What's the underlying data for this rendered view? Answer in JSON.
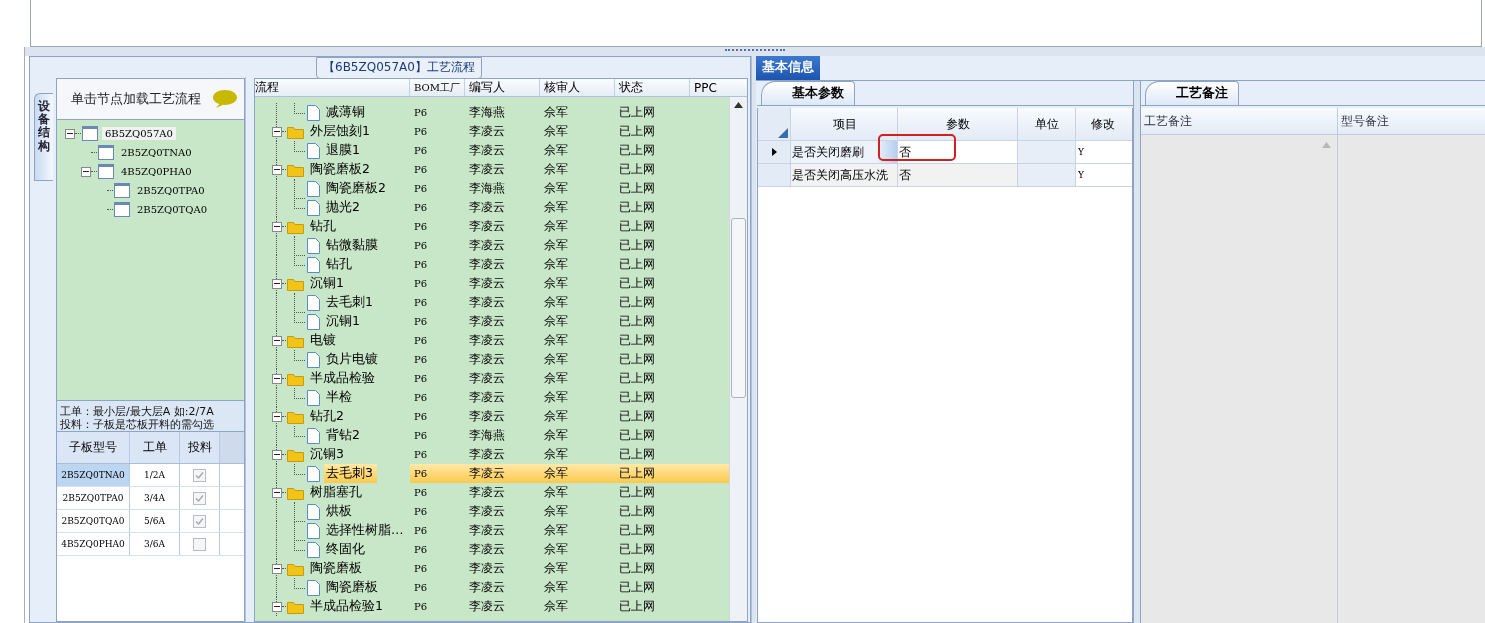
{
  "flow_panel": {
    "title": "【6B5ZQ057A0】工艺流程"
  },
  "side_tab": {
    "label": "设备结构"
  },
  "device_tree": {
    "hint": "单击节点加载工艺流程",
    "nodes": [
      {
        "label": "6B5ZQ057A0",
        "selected": true,
        "expanded": true,
        "children": [
          {
            "label": "2B5ZQ0TNA0",
            "selected": false
          },
          {
            "label": "4B5ZQ0PHA0",
            "selected": false,
            "expanded": true,
            "children": [
              {
                "label": "2B5ZQ0TPA0",
                "selected": false
              },
              {
                "label": "2B5ZQ0TQA0",
                "selected": false
              }
            ]
          }
        ]
      }
    ]
  },
  "notes": [
    "工单：最小层/最大层A 如:2/7A",
    "投料：子板是芯板开料的需勾选"
  ],
  "subboards": {
    "columns": [
      "子板型号",
      "工单",
      "投料"
    ],
    "rows": [
      {
        "model": "2B5ZQ0TNA0",
        "order": "1/2A",
        "feed": true,
        "selected": true
      },
      {
        "model": "2B5ZQ0TPA0",
        "order": "3/4A",
        "feed": true,
        "selected": false
      },
      {
        "model": "2B5ZQ0TQA0",
        "order": "5/6A",
        "feed": true,
        "selected": false
      },
      {
        "model": "4B5ZQ0PHA0",
        "order": "3/6A",
        "feed": false,
        "selected": false
      }
    ]
  },
  "process": {
    "columns": [
      "流程",
      "BOM工厂",
      "编写人",
      "核审人",
      "状态",
      "PPC"
    ],
    "groups": [
      {
        "children": [
          {
            "name": "减薄铜",
            "bom": "P6",
            "writer": "李海燕",
            "reviewer": "佘军",
            "status": "已上网",
            "selected": false
          }
        ]
      },
      {
        "name": "外层蚀刻1",
        "bom": "P6",
        "writer": "李凌云",
        "reviewer": "佘军",
        "status": "已上网",
        "selected": false,
        "expanded": true,
        "children": [
          {
            "name": "退膜1",
            "bom": "P6",
            "writer": "李凌云",
            "reviewer": "佘军",
            "status": "已上网",
            "selected": false
          }
        ]
      },
      {
        "name": "陶瓷磨板2",
        "bom": "P6",
        "writer": "李凌云",
        "reviewer": "佘军",
        "status": "已上网",
        "selected": false,
        "expanded": true,
        "children": [
          {
            "name": "陶瓷磨板2",
            "bom": "P6",
            "writer": "李海燕",
            "reviewer": "佘军",
            "status": "已上网",
            "selected": false
          },
          {
            "name": "抛光2",
            "bom": "P6",
            "writer": "李凌云",
            "reviewer": "佘军",
            "status": "已上网",
            "selected": false
          }
        ]
      },
      {
        "name": "钻孔",
        "bom": "P6",
        "writer": "李凌云",
        "reviewer": "佘军",
        "status": "已上网",
        "selected": false,
        "expanded": true,
        "children": [
          {
            "name": "钻微黏膜",
            "bom": "P6",
            "writer": "李凌云",
            "reviewer": "佘军",
            "status": "已上网",
            "selected": false
          },
          {
            "name": "钻孔",
            "bom": "P6",
            "writer": "李凌云",
            "reviewer": "佘军",
            "status": "已上网",
            "selected": false
          }
        ]
      },
      {
        "name": "沉铜1",
        "bom": "P6",
        "writer": "李凌云",
        "reviewer": "佘军",
        "status": "已上网",
        "selected": false,
        "expanded": true,
        "children": [
          {
            "name": "去毛刺1",
            "bom": "P6",
            "writer": "李凌云",
            "reviewer": "佘军",
            "status": "已上网",
            "selected": false
          },
          {
            "name": "沉铜1",
            "bom": "P6",
            "writer": "李凌云",
            "reviewer": "佘军",
            "status": "已上网",
            "selected": false
          }
        ]
      },
      {
        "name": "电镀",
        "bom": "P6",
        "writer": "李凌云",
        "reviewer": "佘军",
        "status": "已上网",
        "selected": false,
        "expanded": true,
        "children": [
          {
            "name": "负片电镀",
            "bom": "P6",
            "writer": "李凌云",
            "reviewer": "佘军",
            "status": "已上网",
            "selected": false
          }
        ]
      },
      {
        "name": "半成品检验",
        "bom": "P6",
        "writer": "李凌云",
        "reviewer": "佘军",
        "status": "已上网",
        "selected": false,
        "expanded": true,
        "children": [
          {
            "name": "半检",
            "bom": "P6",
            "writer": "李凌云",
            "reviewer": "佘军",
            "status": "已上网",
            "selected": false
          }
        ]
      },
      {
        "name": "钻孔2",
        "bom": "P6",
        "writer": "李凌云",
        "reviewer": "佘军",
        "status": "已上网",
        "selected": false,
        "expanded": true,
        "children": [
          {
            "name": "背钻2",
            "bom": "P6",
            "writer": "李海燕",
            "reviewer": "佘军",
            "status": "已上网",
            "selected": false
          }
        ]
      },
      {
        "name": "沉铜3",
        "bom": "P6",
        "writer": "李凌云",
        "reviewer": "佘军",
        "status": "已上网",
        "selected": false,
        "expanded": true,
        "children": [
          {
            "name": "去毛刺3",
            "bom": "P6",
            "writer": "李凌云",
            "reviewer": "佘军",
            "status": "已上网",
            "selected": true
          }
        ]
      },
      {
        "name": "树脂塞孔",
        "bom": "P6",
        "writer": "李凌云",
        "reviewer": "佘军",
        "status": "已上网",
        "selected": false,
        "expanded": true,
        "children": [
          {
            "name": "烘板",
            "bom": "P6",
            "writer": "李凌云",
            "reviewer": "佘军",
            "status": "已上网",
            "selected": false
          },
          {
            "name": "选择性树脂…",
            "bom": "P6",
            "writer": "李凌云",
            "reviewer": "佘军",
            "status": "已上网",
            "selected": false
          },
          {
            "name": "终固化",
            "bom": "P6",
            "writer": "李凌云",
            "reviewer": "佘军",
            "status": "已上网",
            "selected": false
          }
        ]
      },
      {
        "name": "陶瓷磨板",
        "bom": "P6",
        "writer": "李凌云",
        "reviewer": "佘军",
        "status": "已上网",
        "selected": false,
        "expanded": true,
        "children": [
          {
            "name": "陶瓷磨板",
            "bom": "P6",
            "writer": "李凌云",
            "reviewer": "佘军",
            "status": "已上网",
            "selected": false
          }
        ]
      },
      {
        "name": "半成品检验1",
        "bom": "P6",
        "writer": "李凌云",
        "reviewer": "佘军",
        "status": "已上网",
        "selected": false,
        "expanded": true
      }
    ]
  },
  "info_tab": {
    "label": "基本信息"
  },
  "params": {
    "tab": "基本参数",
    "columns": [
      "项目",
      "参数",
      "单位",
      "修改"
    ],
    "rows": [
      {
        "item": "是否关闭磨刷",
        "value": "否",
        "modify": "Y",
        "selected": true,
        "highlighted": true
      },
      {
        "item": "是否关闭高压水洗",
        "value": "否",
        "modify": "Y",
        "selected": false,
        "highlighted": false
      }
    ]
  },
  "remarks": {
    "tab": "工艺备注",
    "columns": [
      "工艺备注",
      "型号备注"
    ]
  }
}
